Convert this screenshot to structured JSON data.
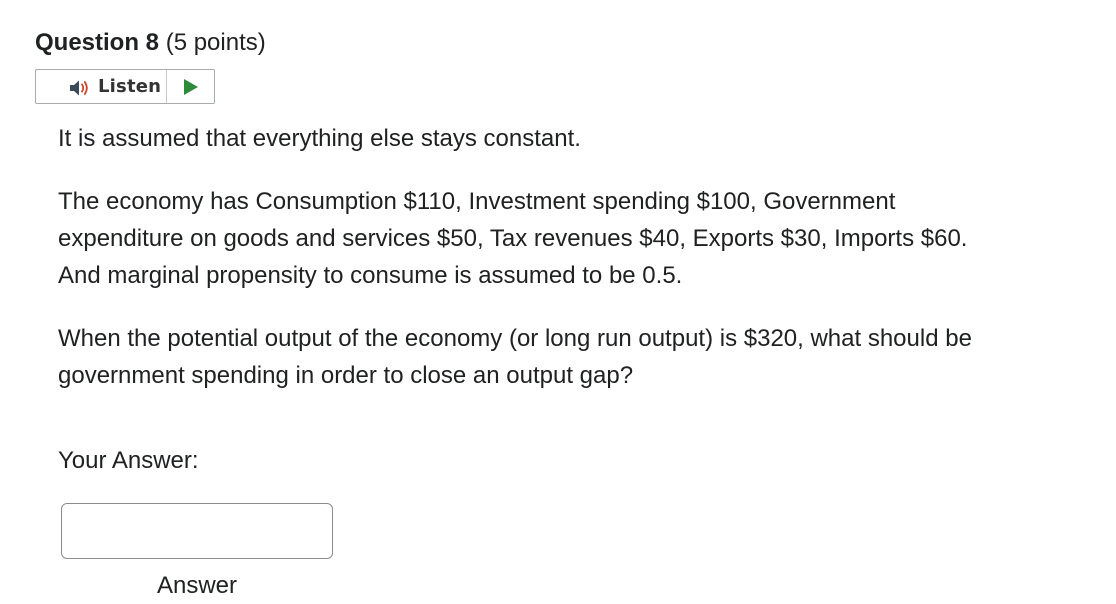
{
  "question": {
    "title": "Question 8",
    "points": "(5 points)"
  },
  "listen": {
    "label": "Listen",
    "speaker_icon": "speaker-icon",
    "play_icon": "play-icon",
    "play_color": "#2e8b3a",
    "speaker_color": "#d2452a"
  },
  "body": {
    "paragraph1": "It is assumed that everything else stays constant.",
    "paragraph2": "The economy has Consumption $110, Investment spending $100, Government expenditure on goods and services $50, Tax revenues $40, Exports $30, Imports $60. And marginal propensity to consume is assumed to be 0.5.",
    "paragraph3": "When the potential output of the economy (or long run output) is $320, what should be government spending in order to close an output gap?"
  },
  "answer": {
    "label": "Your Answer:",
    "value": "",
    "caption": "Answer"
  }
}
